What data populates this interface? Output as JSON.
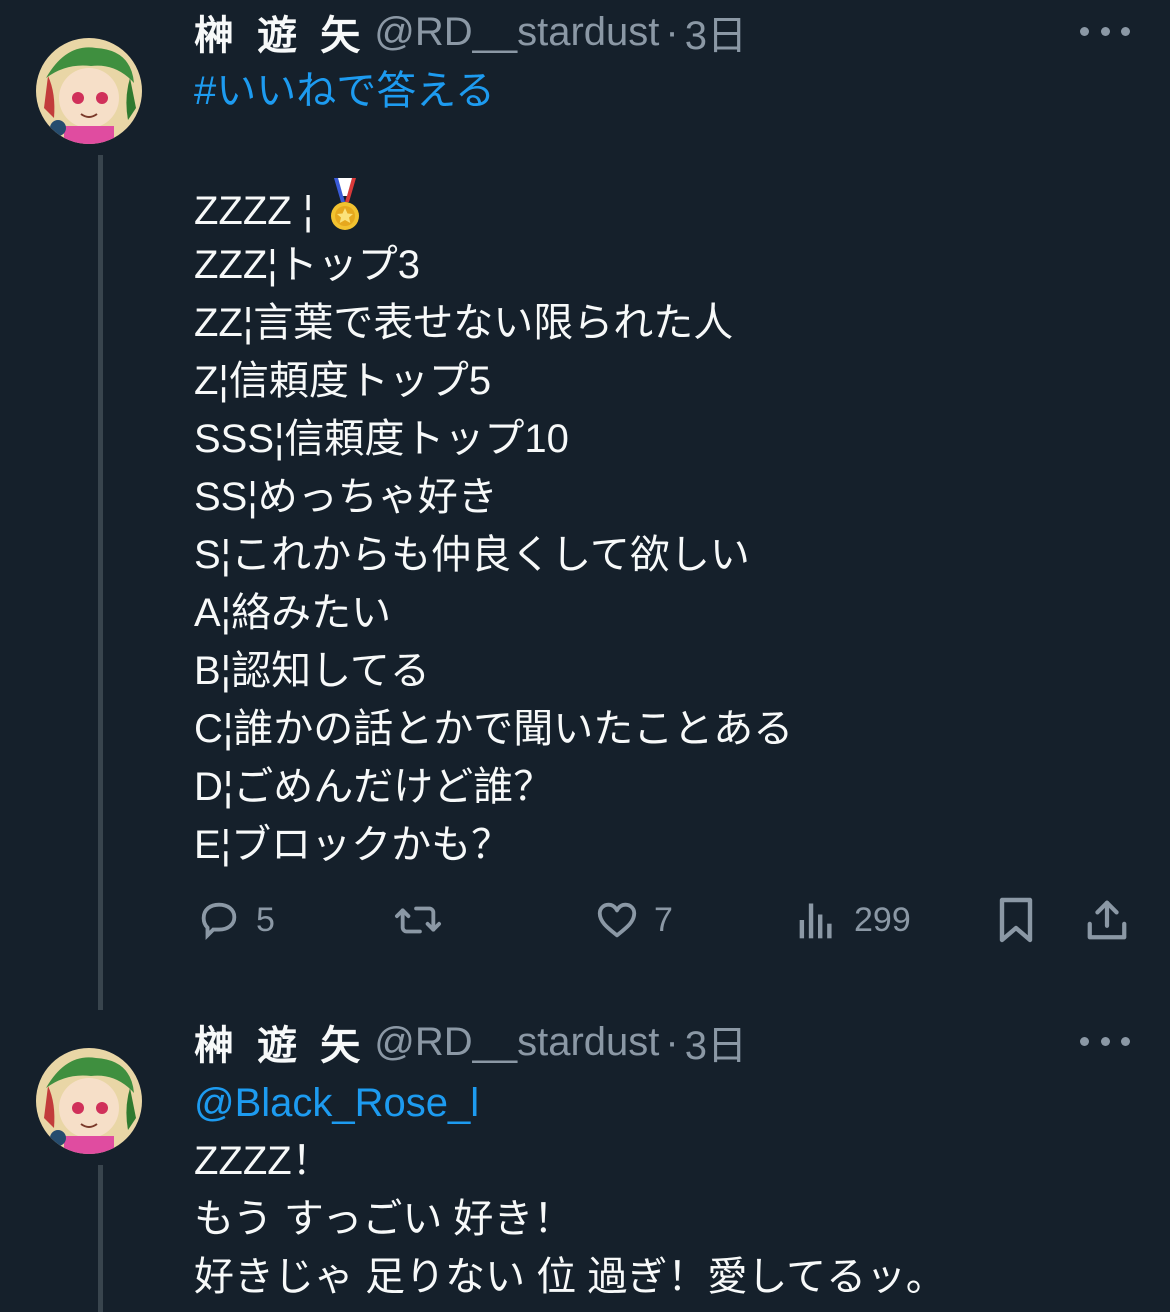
{
  "tweets": [
    {
      "author_name": "榊 遊 矢",
      "handle": "@RD__stardust",
      "separator": "·",
      "time": "3日",
      "hashtag": "#いいねで答える",
      "ranks": [
        {
          "label": "ZZZZ ¦ ",
          "has_medal": true,
          "medal_icon": "medal-icon"
        },
        {
          "label": "ZZZ¦トップ3"
        },
        {
          "label": "ZZ¦言葉で表せない限られた人"
        },
        {
          "label": "Z¦信頼度トップ5"
        },
        {
          "label": "SSS¦信頼度トップ10"
        },
        {
          "label": "SS¦めっちゃ好き"
        },
        {
          "label": "S¦これからも仲良くして欲しい"
        },
        {
          "label": "A¦絡みたい"
        },
        {
          "label": "B¦認知してる"
        },
        {
          "label": "C¦誰かの話とかで聞いたことある"
        },
        {
          "label": "D¦ごめんだけど誰？"
        },
        {
          "label": "E¦ブロックかも？"
        }
      ],
      "actions": {
        "replies": "5",
        "retweets": "",
        "likes": "7",
        "views": "299"
      }
    },
    {
      "author_name": "榊 遊 矢",
      "handle": "@RD__stardust",
      "separator": "·",
      "time": "3日",
      "mention": "@Black_Rose_l",
      "lines": [
        "ZZZZ！",
        "もう すっごい 好き！",
        "好きじゃ 足りない 位 過ぎ！愛してるッ。"
      ]
    }
  ],
  "colors": {
    "background": "#15202b",
    "text": "#f7f9f9",
    "secondary": "#8b98a5",
    "link": "#1d9bf0",
    "thread_line": "#38444d"
  },
  "icons": [
    "reply-icon",
    "retweet-icon",
    "like-icon",
    "views-icon",
    "bookmark-icon",
    "share-icon",
    "more-icon",
    "medal-icon"
  ]
}
